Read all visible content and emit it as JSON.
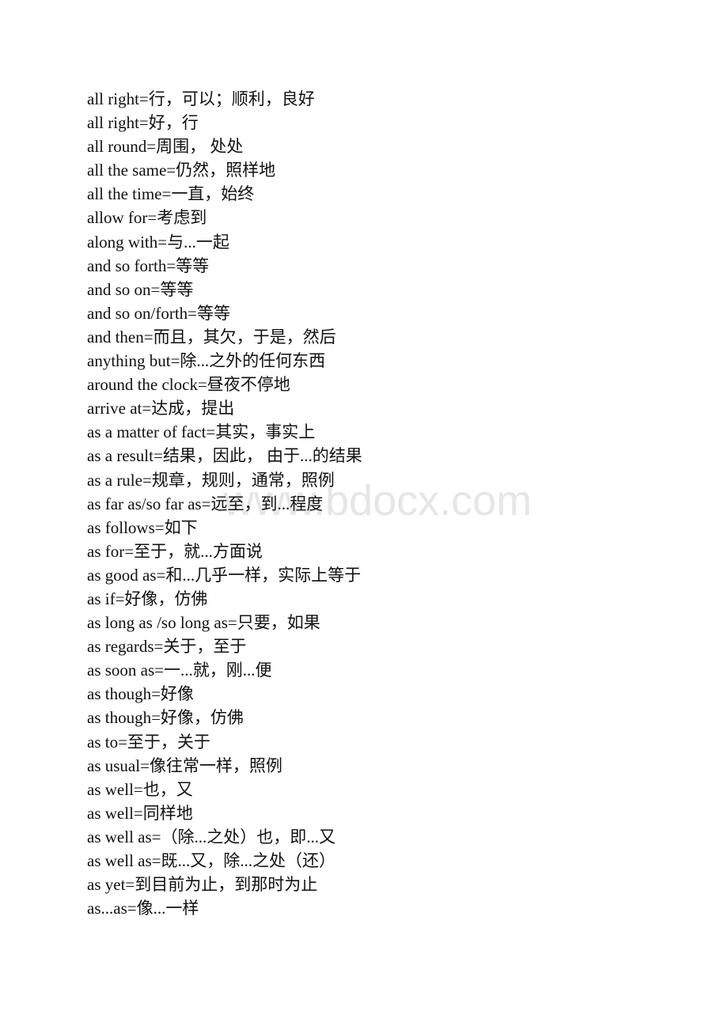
{
  "watermark": "www.bdocx.com",
  "entries": [
    "all right=行，可以；顺利，良好",
    "all right=好，行",
    "all round=周围， 处处",
    "all the same=仍然，照样地",
    "all the time=一直，始终",
    "allow for=考虑到",
    "along with=与...一起",
    "and so forth=等等",
    "and so on=等等",
    "and so on/forth=等等",
    "and then=而且，其欠，于是，然后",
    "anything but=除...之外的任何东西",
    "around the clock=昼夜不停地",
    "arrive at=达成，提出",
    "as a matter of fact=其实，事实上",
    "as a result=结果，因此， 由于...的结果",
    "as a rule=规章，规则，通常，照例",
    "as far as/so far as=远至，到...程度",
    "as follows=如下",
    "as for=至于，就...方面说",
    "as good as=和...几乎一样，实际上等于",
    "as if=好像，仿佛",
    "as long as /so long as=只要，如果",
    "as regards=关于，至于",
    "as soon as=一...就，刚...便",
    "as though=好像",
    "as though=好像，仿佛",
    "as to=至于，关于",
    "as usual=像往常一样，照例",
    "as well=也，又",
    "as well=同样地",
    "as well as=（除...之处）也，即...又",
    "as well as=既...又，除...之处（还）",
    "as yet=到目前为止，到那时为止",
    "as...as=像...一样"
  ]
}
